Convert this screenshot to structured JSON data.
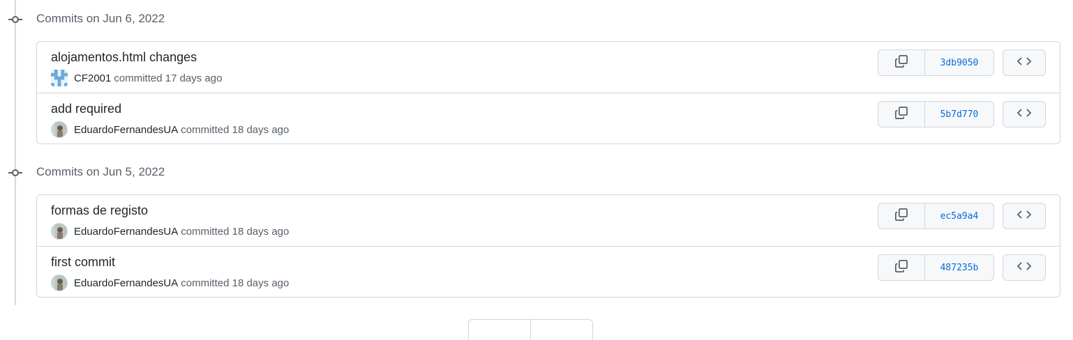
{
  "groups": [
    {
      "title": "Commits on Jun 6, 2022",
      "commits": [
        {
          "message": "alojamentos.html changes",
          "author": "CF2001",
          "meta": "committed 17 days ago",
          "sha": "3db9050",
          "avatar": "identicon"
        },
        {
          "message": "add required",
          "author": "EduardoFernandesUA",
          "meta": "committed 18 days ago",
          "sha": "5b7d770",
          "avatar": "photo"
        }
      ]
    },
    {
      "title": "Commits on Jun 5, 2022",
      "commits": [
        {
          "message": "formas de registo",
          "author": "EduardoFernandesUA",
          "meta": "committed 18 days ago",
          "sha": "ec5a9a4",
          "avatar": "photo"
        },
        {
          "message": "first commit",
          "author": "EduardoFernandesUA",
          "meta": "committed 18 days ago",
          "sha": "487235b",
          "avatar": "photo"
        }
      ]
    }
  ],
  "icons": {
    "timeline_node": "git-commit-icon",
    "copy": "copy-icon",
    "browse": "code-icon"
  },
  "colors": {
    "sha_link": "#0969da",
    "border": "#d0d7de",
    "muted_text": "#57606a"
  }
}
